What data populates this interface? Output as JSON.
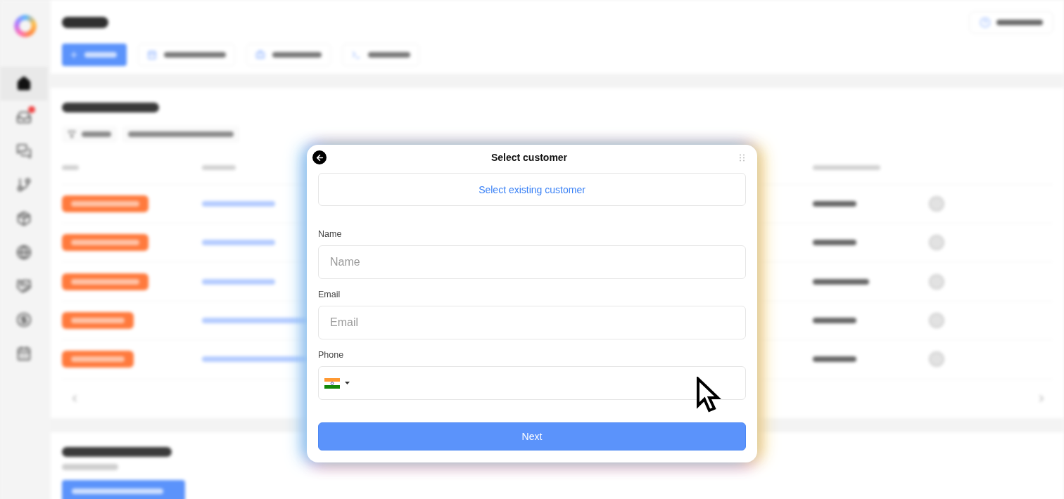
{
  "sidebar": {
    "items": [
      {
        "selected": true,
        "badge": false
      },
      {
        "selected": false,
        "badge": true
      },
      {
        "selected": false,
        "badge": false
      },
      {
        "selected": false,
        "badge": false
      },
      {
        "selected": false,
        "badge": false
      },
      {
        "selected": false,
        "badge": false
      },
      {
        "selected": false,
        "badge": false
      },
      {
        "selected": false,
        "badge": false
      },
      {
        "selected": false,
        "badge": false
      }
    ]
  },
  "dialog": {
    "title": "Select customer",
    "existing_customer_button": "Select existing customer",
    "fields": [
      {
        "kind": "text",
        "label": "Name",
        "placeholder": "Name"
      },
      {
        "kind": "text",
        "label": "Email",
        "placeholder": "Email"
      },
      {
        "kind": "phone",
        "label": "Phone"
      }
    ],
    "submit_button": "Next"
  }
}
